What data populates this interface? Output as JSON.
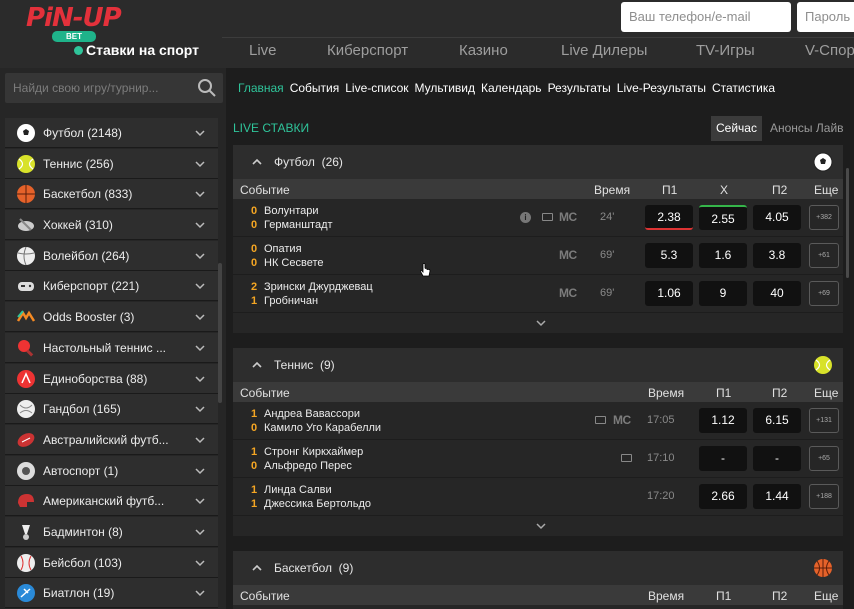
{
  "brand": {
    "logo_text": "PiN-UP",
    "logo_sub": "BET",
    "section": "Ставки на спорт"
  },
  "auth": {
    "phone_placeholder": "Ваш телефон/e-mail",
    "password_placeholder": "Пароль"
  },
  "topnav": [
    "Live",
    "Киберспорт",
    "Казино",
    "Live Дилеры",
    "TV-Игры",
    "V-Спорт"
  ],
  "sidebar": {
    "search_placeholder": "Найди свою игру/турнир...",
    "items": [
      {
        "label": "Футбол (2148)",
        "icon": "football-icon"
      },
      {
        "label": "Теннис (256)",
        "icon": "tennis-icon"
      },
      {
        "label": "Баскетбол (833)",
        "icon": "basketball-icon"
      },
      {
        "label": "Хоккей (310)",
        "icon": "hockey-icon"
      },
      {
        "label": "Волейбол (264)",
        "icon": "volleyball-icon"
      },
      {
        "label": "Киберспорт (221)",
        "icon": "gamepad-icon"
      },
      {
        "label": "Odds Booster (3)",
        "icon": "booster-icon"
      },
      {
        "label": "Настольный теннис ...",
        "icon": "table-tennis-icon"
      },
      {
        "label": "Единоборства (88)",
        "icon": "martial-arts-icon"
      },
      {
        "label": "Гандбол (165)",
        "icon": "handball-icon"
      },
      {
        "label": "Австралийский футб...",
        "icon": "aussie-football-icon"
      },
      {
        "label": "Автоспорт (1)",
        "icon": "motorsport-icon"
      },
      {
        "label": "Американский футб...",
        "icon": "helmet-icon"
      },
      {
        "label": "Бадминтон (8)",
        "icon": "shuttlecock-icon"
      },
      {
        "label": "Бейсбол (103)",
        "icon": "baseball-icon"
      },
      {
        "label": "Биатлон (19)",
        "icon": "biathlon-icon"
      }
    ]
  },
  "subnav": [
    "Главная",
    "События",
    "Live-список",
    "Мультивид",
    "Календарь",
    "Результаты",
    "Live-Результаты",
    "Статистика"
  ],
  "live": {
    "title": "LIVE СТАВКИ",
    "tab_now": "Сейчас",
    "tab_announce": "Анонсы Лайв"
  },
  "football": {
    "name": "Футбол",
    "count": "(26)",
    "cols": {
      "event": "Событие",
      "time": "Время",
      "p1": "П1",
      "x": "Х",
      "p2": "П2",
      "more": "Еще"
    },
    "rows": [
      {
        "s1": "0",
        "t1": "Волунтари",
        "s2": "0",
        "t2": "Германштадт",
        "mc": "MC",
        "time": "24'",
        "p1": "2.38",
        "x": "2.55",
        "p2": "4.05",
        "more": "+382"
      },
      {
        "s1": "0",
        "t1": "Опатия",
        "s2": "0",
        "t2": "НК Сесвете",
        "mc": "MC",
        "time": "69'",
        "p1": "5.3",
        "x": "1.6",
        "p2": "3.8",
        "more": "+61"
      },
      {
        "s1": "2",
        "t1": "Зрински Джурджевац",
        "s2": "1",
        "t2": "Гробничан",
        "mc": "MC",
        "time": "69'",
        "p1": "1.06",
        "x": "9",
        "p2": "40",
        "more": "+69"
      }
    ]
  },
  "tennis": {
    "name": "Теннис",
    "count": "(9)",
    "cols": {
      "event": "Событие",
      "time": "Время",
      "p1": "П1",
      "p2": "П2",
      "more": "Еще"
    },
    "rows": [
      {
        "s1": "1",
        "t1": "Андреа Вавассори",
        "s2": "0",
        "t2": "Камило Уго Карабелли",
        "mc": "MC",
        "time": "17:05",
        "p1": "1.12",
        "p2": "6.15",
        "more": "+131"
      },
      {
        "s1": "1",
        "t1": "Стронг Киркхаймер",
        "s2": "0",
        "t2": "Альфредо Перес",
        "time": "17:10",
        "p1": "-",
        "p2": "-",
        "more": "+65"
      },
      {
        "s1": "1",
        "t1": "Линда Салви",
        "s2": "1",
        "t2": "Джессика Бертольдо",
        "time": "17:20",
        "p1": "2.66",
        "p2": "1.44",
        "more": "+188"
      }
    ]
  },
  "basketball": {
    "name": "Баскетбол",
    "count": "(9)",
    "cols": {
      "event": "Событие",
      "time": "Время",
      "p1": "П1",
      "p2": "П2",
      "more": "Еще"
    }
  },
  "colors": {
    "accent": "#2fc49a",
    "score": "#f5a623",
    "brand_red": "#e3313b"
  }
}
